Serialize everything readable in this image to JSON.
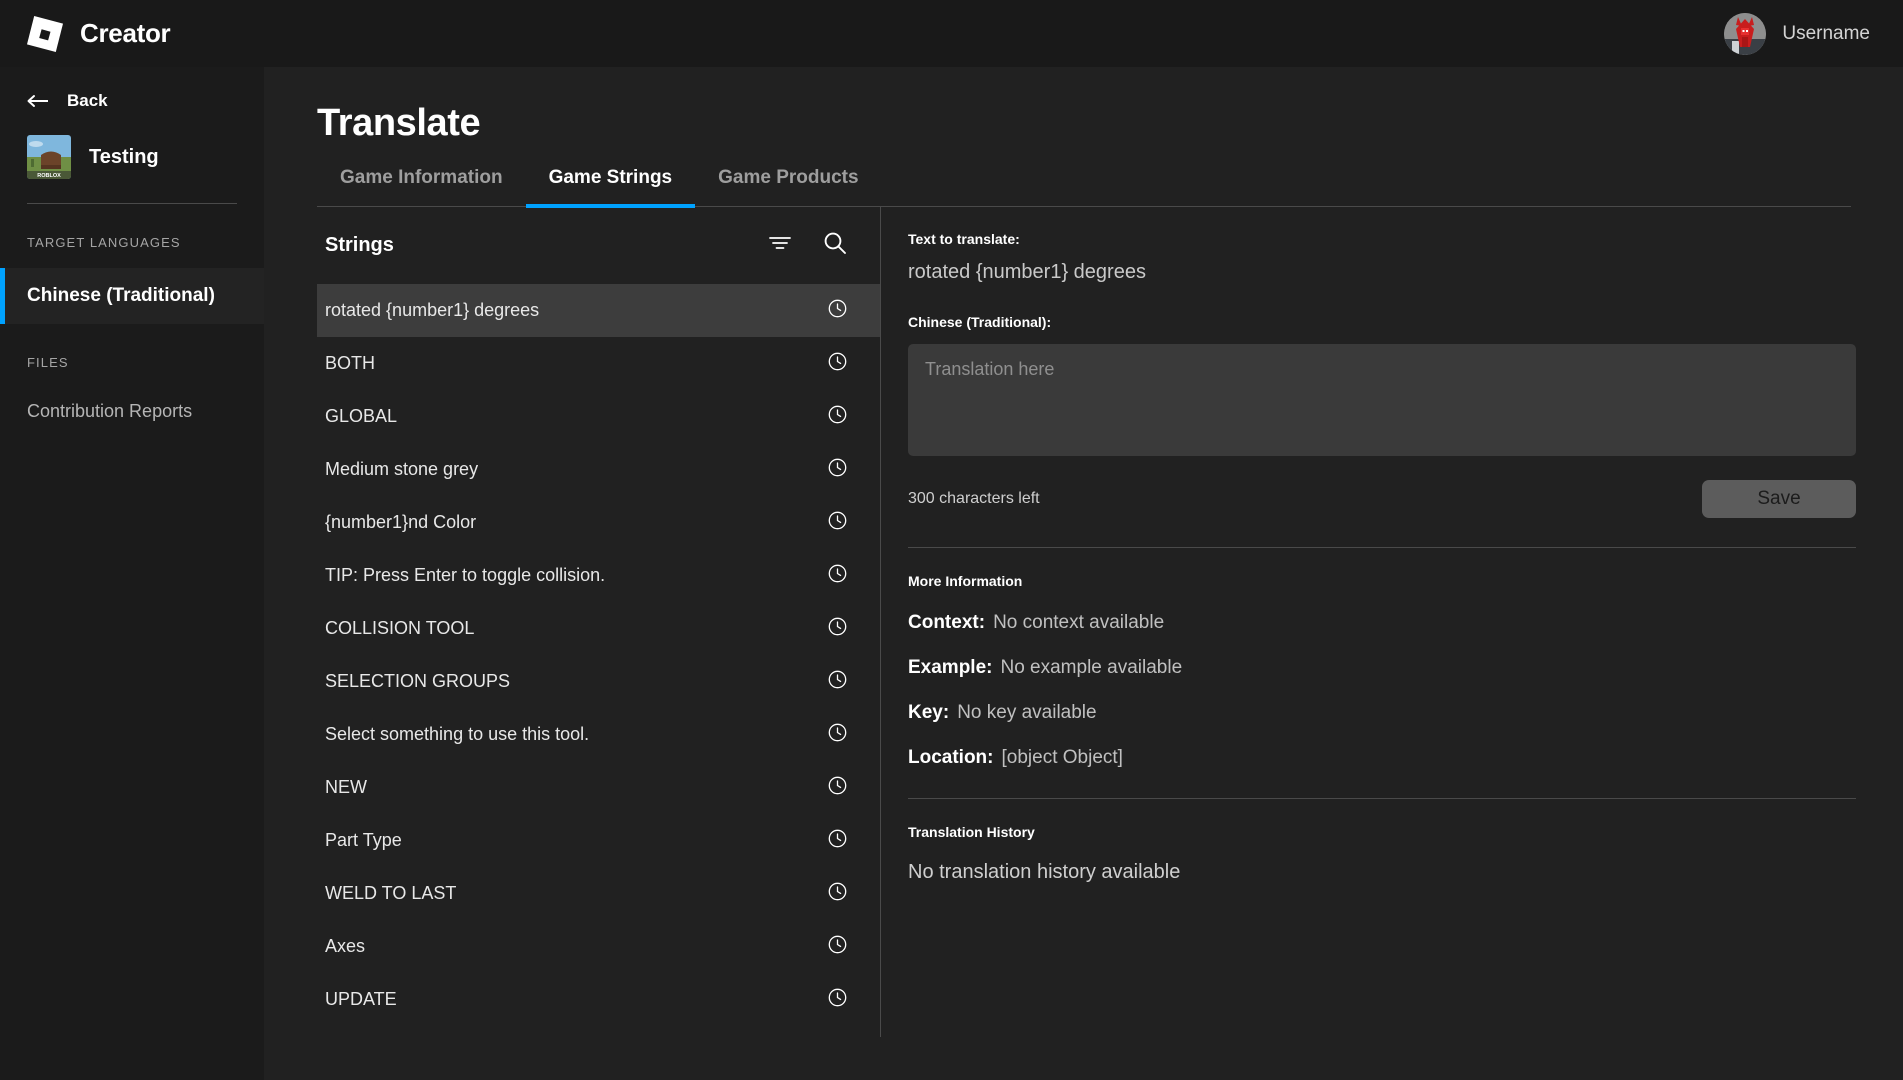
{
  "topbar": {
    "brand": "Creator",
    "logo_icon": "roblox-logo-icon",
    "username": "Username",
    "avatar_icon": "user-avatar"
  },
  "sidebar": {
    "back_label": "Back",
    "back_icon": "arrow-left-icon",
    "game_name": "Testing",
    "game_thumb_icon": "game-thumbnail",
    "target_languages_header": "TARGET LANGUAGES",
    "languages": [
      {
        "label": "Chinese (Traditional)",
        "active": true
      }
    ],
    "files_header": "FILES",
    "files_links": [
      {
        "label": "Contribution Reports"
      }
    ],
    "accent_color": "#00a2ff"
  },
  "main": {
    "page_title": "Translate",
    "tabs": [
      {
        "label": "Game Information",
        "active": false
      },
      {
        "label": "Game Strings",
        "active": true
      },
      {
        "label": "Game Products",
        "active": false
      }
    ],
    "active_tab_color": "#00a2ff"
  },
  "strings_panel": {
    "title": "Strings",
    "filter_icon": "filter-icon",
    "search_icon": "search-icon",
    "row_icon": "clock-history-icon",
    "items": [
      {
        "text": "rotated {number1} degrees",
        "selected": true
      },
      {
        "text": "BOTH",
        "selected": false
      },
      {
        "text": "GLOBAL",
        "selected": false
      },
      {
        "text": "Medium stone grey",
        "selected": false
      },
      {
        "text": "{number1}nd Color",
        "selected": false
      },
      {
        "text": "TIP: Press Enter to toggle collision.",
        "selected": false
      },
      {
        "text": "COLLISION TOOL",
        "selected": false
      },
      {
        "text": "SELECTION GROUPS",
        "selected": false
      },
      {
        "text": "Select something to use this tool.",
        "selected": false
      },
      {
        "text": "NEW",
        "selected": false
      },
      {
        "text": "Part Type",
        "selected": false
      },
      {
        "text": "WELD TO LAST",
        "selected": false
      },
      {
        "text": "Axes",
        "selected": false
      },
      {
        "text": "UPDATE",
        "selected": false
      }
    ]
  },
  "translation_panel": {
    "source_label": "Text to translate:",
    "source_text": "rotated {number1} degrees",
    "target_label": "Chinese (Traditional):",
    "translation_value": "",
    "translation_placeholder": "Translation here",
    "char_count": "300 characters left",
    "save_label": "Save",
    "more_info_header": "More Information",
    "info_rows": [
      {
        "key": "Context:",
        "value": "No context available"
      },
      {
        "key": "Example:",
        "value": "No example available"
      },
      {
        "key": "Key:",
        "value": "No key available"
      },
      {
        "key": "Location:",
        "value": "[object Object]"
      }
    ],
    "history_header": "Translation History",
    "history_empty": "No translation history available"
  }
}
